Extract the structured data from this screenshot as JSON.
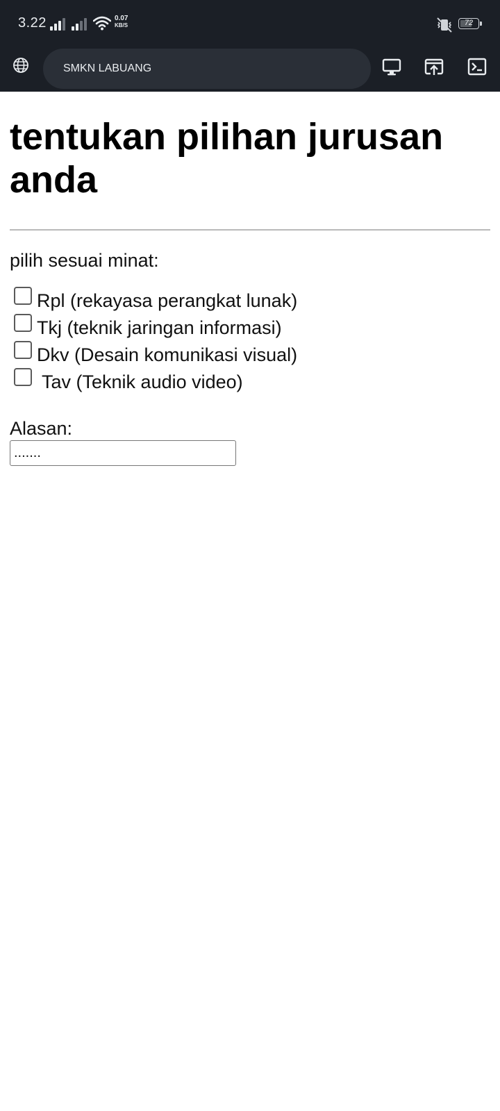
{
  "status_bar": {
    "time": "3.22",
    "net_speed_value": "0.07",
    "net_speed_unit": "KB/S",
    "battery_level": "72",
    "icons": [
      "signal-icon",
      "signal-icon",
      "wifi-icon",
      "vibrate-mute-icon",
      "battery-icon"
    ]
  },
  "browser": {
    "url_text": "SMKN LABUANG",
    "icons": [
      "globe-icon",
      "desktop-icon",
      "open-upload-icon",
      "terminal-icon"
    ],
    "colors": {
      "bar": "#1b1f26",
      "url_field": "#2a2f37"
    }
  },
  "page": {
    "heading": "tentukan pilihan jurusan anda",
    "prompt": "pilih sesuai minat:",
    "options": [
      {
        "label": "Rpl (rekayasa perangkat lunak)",
        "checked": false
      },
      {
        "label": "Tkj (teknik jaringan informasi)",
        "checked": false
      },
      {
        "label": "Dkv (Desain komunikasi visual)",
        "checked": false
      },
      {
        "label": " Tav (Teknik audio video)",
        "checked": false
      }
    ],
    "reason_label": "Alasan:",
    "reason_value": "......."
  }
}
